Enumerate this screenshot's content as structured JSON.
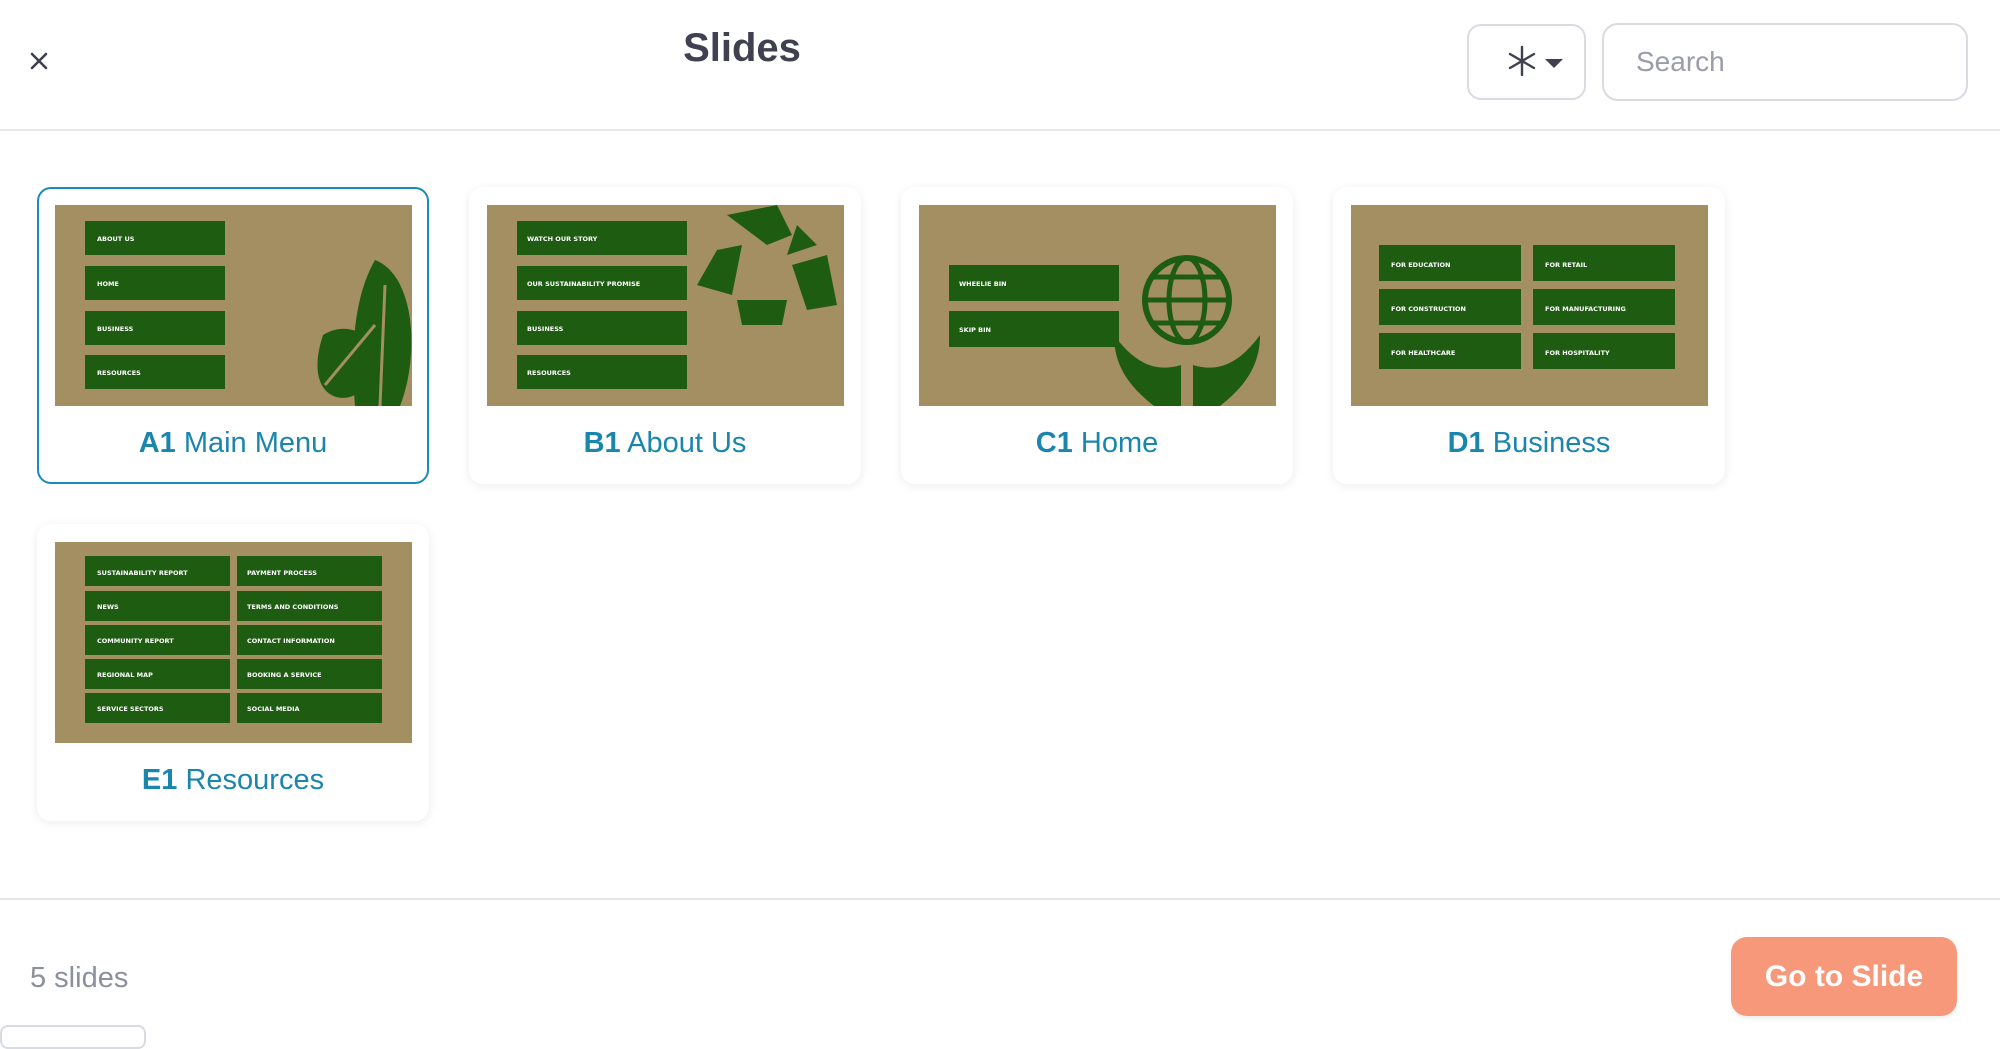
{
  "header": {
    "title": "Slides",
    "close_icon": "close-icon",
    "filter_icon": "asterisk-icon",
    "search_placeholder": "Search"
  },
  "colors": {
    "accent": "#1a86ad",
    "primary_button": "#f8987a",
    "thumbnail_bg": "#a48f63",
    "thumbnail_green": "#1e5c12"
  },
  "slides": [
    {
      "code": "A1",
      "name": "Main Menu",
      "selected": true,
      "thumbnail": {
        "graphic": "leaves-icon",
        "menu_items": [
          "ABOUT US",
          "HOME",
          "BUSINESS",
          "RESOURCES"
        ]
      }
    },
    {
      "code": "B1",
      "name": "About Us",
      "selected": false,
      "thumbnail": {
        "graphic": "recycle-icon",
        "menu_items": [
          "WATCH OUR STORY",
          "OUR SUSTAINABILITY PROMISE",
          "BUSINESS",
          "RESOURCES"
        ]
      }
    },
    {
      "code": "C1",
      "name": "Home",
      "selected": false,
      "thumbnail": {
        "graphic": "globe-in-hands-icon",
        "menu_items": [
          "WHEELIE BIN",
          "SKIP BIN"
        ]
      }
    },
    {
      "code": "D1",
      "name": "Business",
      "selected": false,
      "thumbnail": {
        "graphic": "none",
        "menu_items": [
          "FOR EDUCATION",
          "FOR RETAIL",
          "FOR CONSTRUCTION",
          "FOR MANUFACTURING",
          "FOR HEALTHCARE",
          "FOR HOSPITALITY"
        ]
      }
    },
    {
      "code": "E1",
      "name": "Resources",
      "selected": false,
      "thumbnail": {
        "graphic": "none",
        "menu_items": [
          "SUSTAINABILITY REPORT",
          "PAYMENT PROCESS",
          "NEWS",
          "TERMS AND CONDITIONS",
          "COMMUNITY REPORT",
          "CONTACT INFORMATION",
          "REGIONAL MAP",
          "BOOKING A SERVICE",
          "SERVICE SECTORS",
          "SOCIAL MEDIA"
        ]
      }
    }
  ],
  "footer": {
    "count_label": "5 slides",
    "go_button": "Go to Slide"
  }
}
